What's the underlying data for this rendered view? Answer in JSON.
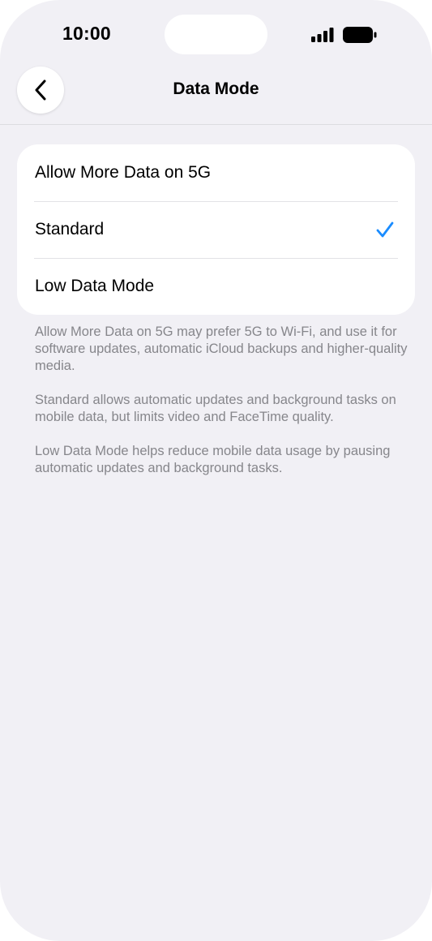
{
  "status_bar": {
    "time": "10:00",
    "signal_icon": "cellular-signal-icon",
    "battery_icon": "battery-icon"
  },
  "nav": {
    "back_icon": "chevron-left-icon",
    "title": "Data Mode"
  },
  "options": [
    {
      "label": "Allow More Data on 5G",
      "selected": false
    },
    {
      "label": "Standard",
      "selected": true
    },
    {
      "label": "Low Data Mode",
      "selected": false
    }
  ],
  "descriptions": [
    "Allow More Data on 5G may prefer 5G to Wi-Fi, and use it for software updates, automatic iCloud backups and higher-quality media.",
    "Standard allows automatic updates and background tasks on mobile data, but limits video and FaceTime quality.",
    "Low Data Mode helps reduce mobile data usage by pausing automatic updates and background tasks."
  ],
  "colors": {
    "accent": "#1a8cff",
    "background": "#f1f0f5",
    "card": "#ffffff",
    "secondary_text": "#86868b"
  }
}
